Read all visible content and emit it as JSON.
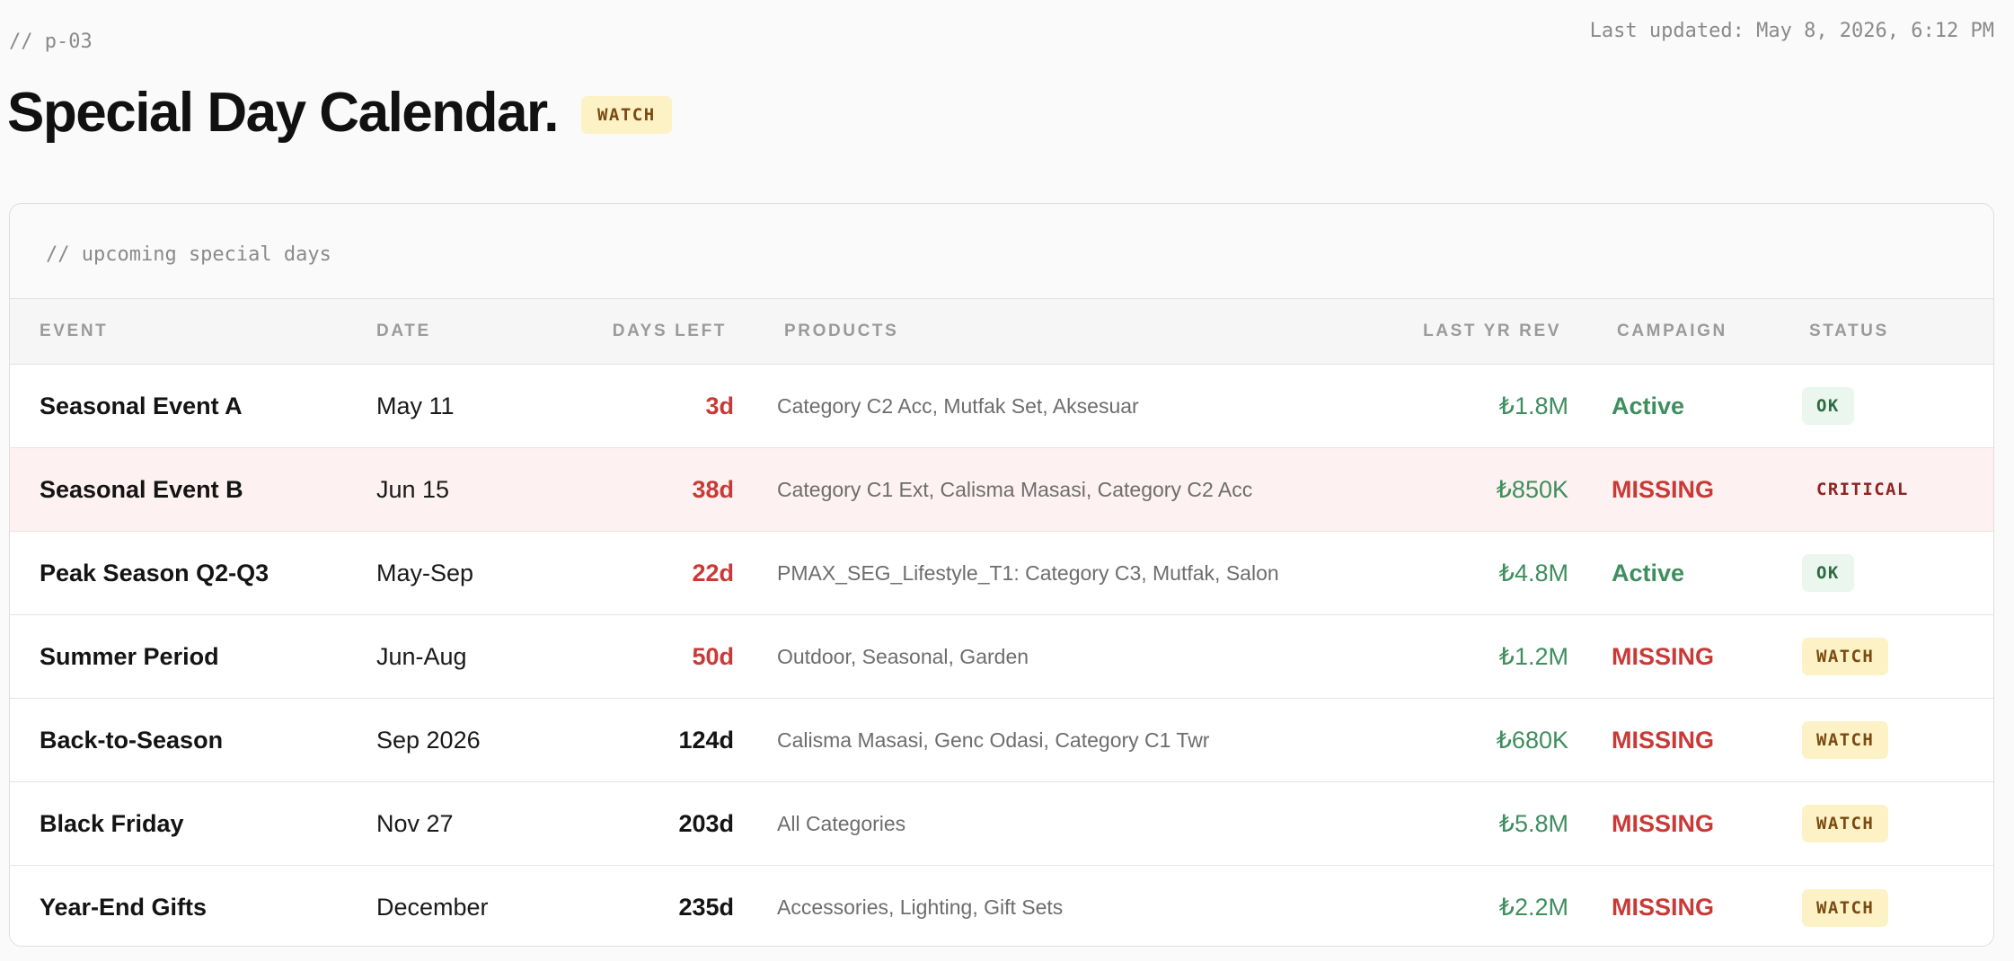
{
  "header": {
    "page_id": "// p-03",
    "last_updated": "Last updated: May 8, 2026, 6:12 PM",
    "title": "Special Day Calendar.",
    "status_badge": "WATCH"
  },
  "table": {
    "caption": "// upcoming special days",
    "columns": {
      "event": "EVENT",
      "date": "DATE",
      "days_left": "DAYS LEFT",
      "products": "PRODUCTS",
      "last_yr_rev": "LAST YR REV",
      "campaign": "CAMPAIGN",
      "status": "STATUS"
    },
    "rows": [
      {
        "event": "Seasonal Event A",
        "date": "May 11",
        "days_left": "3d",
        "products": "Category C2 Acc, Mutfak Set, Aksesuar",
        "last_yr_rev": "₺1.8M",
        "campaign": "Active",
        "status": "OK"
      },
      {
        "event": "Seasonal Event B",
        "date": "Jun 15",
        "days_left": "38d",
        "products": "Category C1 Ext, Calisma Masasi, Category C2 Acc",
        "last_yr_rev": "₺850K",
        "campaign": "MISSING",
        "status": "CRITICAL"
      },
      {
        "event": "Peak Season Q2-Q3",
        "date": "May-Sep",
        "days_left": "22d",
        "products": "PMAX_SEG_Lifestyle_T1: Category C3, Mutfak, Salon",
        "last_yr_rev": "₺4.8M",
        "campaign": "Active",
        "status": "OK"
      },
      {
        "event": "Summer Period",
        "date": "Jun-Aug",
        "days_left": "50d",
        "products": "Outdoor, Seasonal, Garden",
        "last_yr_rev": "₺1.2M",
        "campaign": "MISSING",
        "status": "WATCH"
      },
      {
        "event": "Back-to-Season",
        "date": "Sep 2026",
        "days_left": "124d",
        "products": "Calisma Masasi, Genc Odasi, Category C1 Twr",
        "last_yr_rev": "₺680K",
        "campaign": "MISSING",
        "status": "WATCH"
      },
      {
        "event": "Black Friday",
        "date": "Nov 27",
        "days_left": "203d",
        "products": "All Categories",
        "last_yr_rev": "₺5.8M",
        "campaign": "MISSING",
        "status": "WATCH"
      },
      {
        "event": "Year-End Gifts",
        "date": "December",
        "days_left": "235d",
        "products": "Accessories, Lighting, Gift Sets",
        "last_yr_rev": "₺2.2M",
        "campaign": "MISSING",
        "status": "WATCH"
      }
    ]
  },
  "colors": {
    "urgent_red": "#c93a37",
    "active_green": "#3e8e5e",
    "watch_badge_bg": "#fdf1c6",
    "ok_badge_bg": "#eaf6ee",
    "critical_row_bg": "#fdf2f1"
  }
}
